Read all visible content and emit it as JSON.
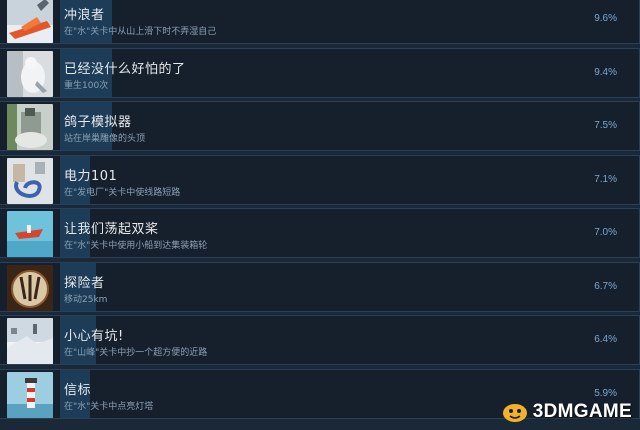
{
  "achievements": [
    {
      "title": "冲浪者",
      "desc": "在\"水\"关卡中从山上滑下时不弄湿自己",
      "percent": "9.6%",
      "bar": 0.09,
      "thumb": "surfer-icon"
    },
    {
      "title": "已经没什么好怕的了",
      "desc": "重生100次",
      "percent": "9.4%",
      "bar": 0.09,
      "thumb": "fearless-icon"
    },
    {
      "title": "鸽子模拟器",
      "desc": "站在岸巢雕像的头顶",
      "percent": "7.5%",
      "bar": 0.07,
      "thumb": "pigeon-icon"
    },
    {
      "title": "电力101",
      "desc": "在\"发电厂\"关卡中使线路短路",
      "percent": "7.1%",
      "bar": 0.07,
      "thumb": "power-icon"
    },
    {
      "title": "让我们荡起双桨",
      "desc": "在\"水\"关卡中使用小船到达集装箱轮",
      "percent": "7.0%",
      "bar": 0.07,
      "thumb": "rowboat-icon"
    },
    {
      "title": "探险者",
      "desc": "移动25km",
      "percent": "6.7%",
      "bar": 0.06,
      "thumb": "explorer-icon"
    },
    {
      "title": "小心有坑!",
      "desc": "在\"山峰\"关卡中抄一个超方便的近路",
      "percent": "6.4%",
      "bar": 0.06,
      "thumb": "pit-icon"
    },
    {
      "title": "信标",
      "desc": "在\"水\"关卡中点亮灯塔",
      "percent": "5.9%",
      "bar": 0.05,
      "thumb": "beacon-icon"
    }
  ],
  "watermark": {
    "text": "3DMGAME"
  }
}
